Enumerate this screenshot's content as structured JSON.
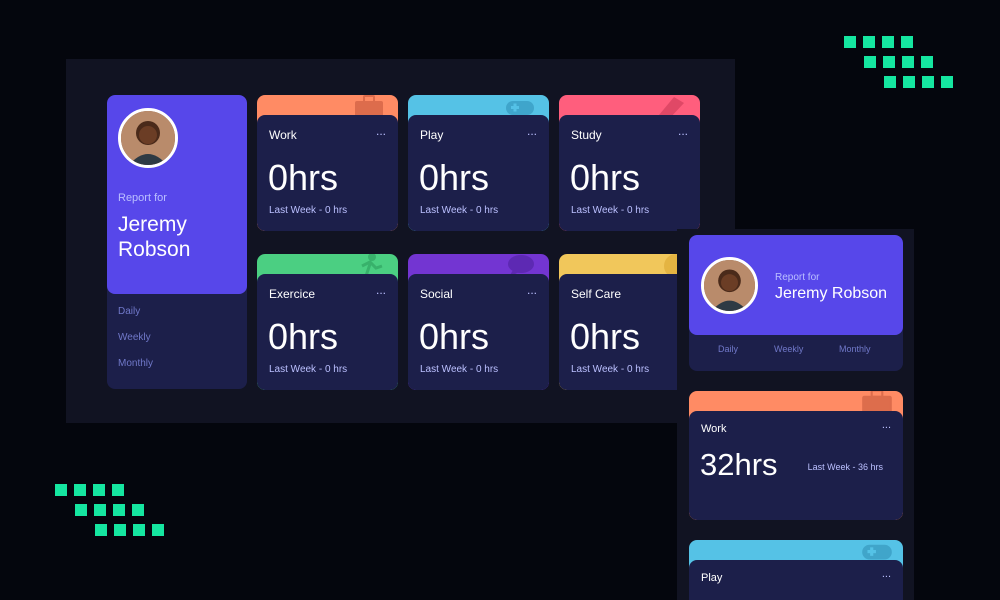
{
  "colors": {
    "background": "#04060d",
    "panel": "#111322",
    "card": "#1c1f4a",
    "profile_accent": "#5747ea",
    "decoration": "#15e6a0",
    "work": "#ff8b64",
    "play": "#55c2e6",
    "study": "#ff5e7d",
    "exercise": "#4bcf82",
    "social": "#7335d2",
    "self_care": "#f1c75b"
  },
  "desktop": {
    "profile": {
      "report_for": "Report for",
      "name_line1": "Jeremy",
      "name_line2": "Robson",
      "timeframes": [
        "Daily",
        "Weekly",
        "Monthly"
      ]
    },
    "cards": [
      {
        "title": "Work",
        "menu": "...",
        "hours": "0hrs",
        "last_week": "Last Week - 0 hrs",
        "icon": "briefcase-icon"
      },
      {
        "title": "Play",
        "menu": "...",
        "hours": "0hrs",
        "last_week": "Last Week - 0 hrs",
        "icon": "gamepad-icon"
      },
      {
        "title": "Study",
        "menu": "...",
        "hours": "0hrs",
        "last_week": "Last Week - 0 hrs",
        "icon": "book-icon"
      },
      {
        "title": "Exercice",
        "menu": "...",
        "hours": "0hrs",
        "last_week": "Last Week - 0 hrs",
        "icon": "runner-icon"
      },
      {
        "title": "Social",
        "menu": "...",
        "hours": "0hrs",
        "last_week": "Last Week - 0 hrs",
        "icon": "chat-icon"
      },
      {
        "title": "Self Care",
        "menu": "...",
        "hours": "0hrs",
        "last_week": "Last Week - 0 hrs",
        "icon": "heart-icon"
      }
    ]
  },
  "mobile": {
    "profile": {
      "report_for": "Report for",
      "name": "Jeremy Robson",
      "timeframes": [
        "Daily",
        "Weekly",
        "Monthly"
      ]
    },
    "cards": [
      {
        "title": "Work",
        "menu": "...",
        "hours": "32hrs",
        "last_week": "Last Week - 36 hrs",
        "icon": "briefcase-icon"
      },
      {
        "title": "Play",
        "menu": "...",
        "icon": "gamepad-icon"
      }
    ]
  }
}
